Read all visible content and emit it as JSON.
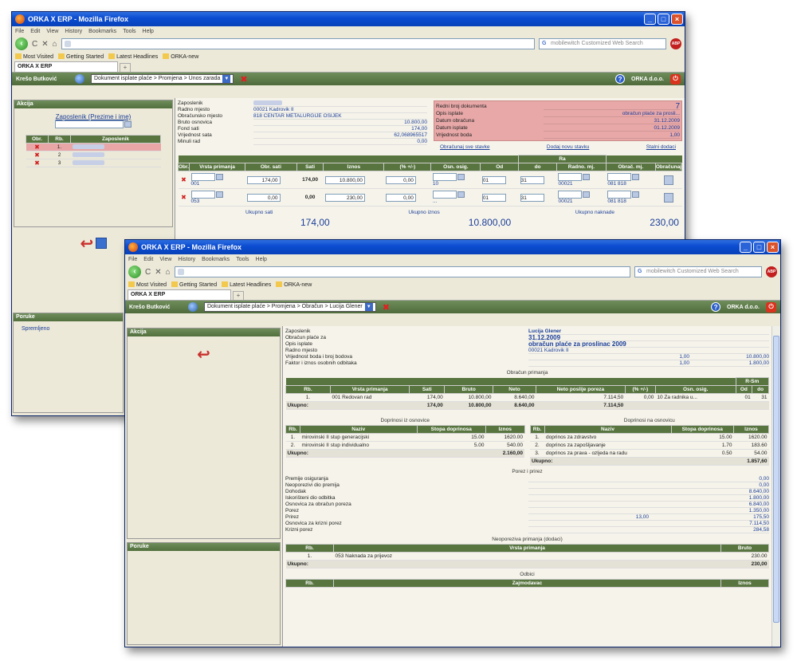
{
  "win1": {
    "title": "ORKA X ERP - Mozilla Firefox",
    "menus": [
      "File",
      "Edit",
      "View",
      "History",
      "Bookmarks",
      "Tools",
      "Help"
    ],
    "search_placeholder": "mobilewitch Customized Web Search",
    "bookmarks": [
      "Most Visited",
      "Getting Started",
      "Latest Headlines",
      "ORKA-new"
    ],
    "tab": "ORKA X ERP",
    "user": "Krešo Butković",
    "breadcrumb": "Dokument isplate plaće > Promjena > Unos zarada",
    "company": "ORKA d.o.o.",
    "akcija_title": "Akcija",
    "zaposlenik_link": "Zaposlenik (Prezime i ime)",
    "emp_table": {
      "headers": [
        "Obr.",
        "Rb.",
        "Zaposlenik"
      ],
      "rows": [
        {
          "rb": "1."
        },
        {
          "rb": "2"
        },
        {
          "rb": "3"
        }
      ]
    },
    "info_labels": [
      "Zaposlenik",
      "Radno mjesto",
      "Obračunsko mjesto",
      "Bruto osnovica",
      "Fond sati",
      "Vrijednost sata",
      "Minuli rad"
    ],
    "info_values": [
      "",
      "00021 Kadrovik II",
      "818 CENTAR METALURGIJE OSIJEK",
      "10.800,00",
      "174,00",
      "62,068965517",
      "0,00"
    ],
    "doc_labels": [
      "Redni broj dokumenta",
      "Opis isplate",
      "Datum obračuna",
      "Datum isplate",
      "Vrijednost boda"
    ],
    "doc_values": [
      "7",
      "obračun plaće za prosli...",
      "31.12.2009",
      "01.12.2009",
      "1,00"
    ],
    "actions": [
      "Obračunaj sve stavke",
      "Dodaj novu stavku",
      "Stalni dodaci"
    ],
    "grid_group": "Ra",
    "grid_headers": [
      "Obr.",
      "Vrsta primanja",
      "Obr. sati",
      "Sati",
      "Iznos",
      "(% +/-)",
      "Osn. osig.",
      "Od",
      "do",
      "Radno. mj.",
      "Obrač. mj.",
      "Obračunaj"
    ],
    "grid_rows": [
      {
        "code": "001",
        "obr_sati": "174,00",
        "sati": "174,00",
        "iznos": "10.800,00",
        "pct": "0,00",
        "osn": "10",
        "od": "01",
        "do": "31",
        "rm": "00021",
        "om": "081 818"
      },
      {
        "code": "053",
        "obr_sati": "0,00",
        "sati": "0,00",
        "iznos": "230,00",
        "pct": "0,00",
        "osn": "...",
        "od": "01",
        "do": "31",
        "rm": "00021",
        "om": "081 818"
      }
    ],
    "totals_labels": [
      "Ukupno sati",
      "Ukupno iznos",
      "Ukupno naknade"
    ],
    "totals_values": [
      "174,00",
      "10.800,00",
      "230,00"
    ]
  },
  "win2": {
    "title": "ORKA X ERP - Mozilla Firefox",
    "menus": [
      "File",
      "Edit",
      "View",
      "History",
      "Bookmarks",
      "Tools",
      "Help"
    ],
    "search_placeholder": "mobilewitch Customized Web Search",
    "bookmarks": [
      "Most Visited",
      "Getting Started",
      "Latest Headlines",
      "ORKA-new"
    ],
    "tab": "ORKA X ERP",
    "user": "Krešo Butković",
    "breadcrumb": "Dokument isplate plaće > Promjena > Obračun > Lucija Glener",
    "company": "ORKA d.o.o.",
    "poruke_title": "Poruke",
    "poruke_msg": "Spremljeno",
    "akcija_title": "Akcija",
    "header_labels": [
      "Zaposlenik",
      "Obračun plaće za",
      "Opis isplate",
      "Radno mjesto",
      "Vrijednost boda i broj bodova",
      "Faktor i iznos osobnih odbitaka"
    ],
    "header_values": [
      "Lucija Glener",
      "31.12.2009",
      "obračun plaće za proslinac 2009",
      "00021 Kadrovik II",
      "1,00",
      "1,00"
    ],
    "header_extra": [
      "",
      "",
      "",
      "",
      "10.800,00",
      "1.800,00"
    ],
    "obracun_title": "Obračun primanja",
    "obracun_group": "R-Sm",
    "obracun_headers": [
      "Rb.",
      "Vrsta primanja",
      "Sati",
      "Bruto",
      "Neto",
      "Neto poslije poreza",
      "(% +/-)",
      "Osn. osig.",
      "Od",
      "do"
    ],
    "obracun_rows": [
      [
        "1.",
        "001 Redovan rad",
        "174,00",
        "10.800,00",
        "8.640,00",
        "7.114,50",
        "0,00",
        "10 Za radnika u...",
        "01",
        "31"
      ]
    ],
    "obracun_total": [
      "Ukupno:",
      "",
      "174,00",
      "10.800,00",
      "8.640,00",
      "7.114,50",
      "",
      "",
      "",
      ""
    ],
    "doprinosi_iz_title": "Doprinosi iz osnovice",
    "doprinosi_iz_headers": [
      "Rb.",
      "Naziv",
      "Stopa doprinosa",
      "Iznos"
    ],
    "doprinosi_iz_rows": [
      [
        "1.",
        "mirovinski II stup generacijski",
        "15.00",
        "1620.00"
      ],
      [
        "2.",
        "mirovinski II stup individualno",
        "5.00",
        "540.00"
      ]
    ],
    "doprinosi_iz_total": [
      "Ukupno:",
      "",
      "",
      "2.160,00"
    ],
    "doprinosi_na_title": "Doprinosi na osnovicu",
    "doprinosi_na_headers": [
      "Rb.",
      "Naziv",
      "Stopa doprinosa",
      "Iznos"
    ],
    "doprinosi_na_rows": [
      [
        "1.",
        "doprinos za zdravstvo",
        "15.00",
        "1620.00"
      ],
      [
        "2.",
        "doprinos za zapošljavanje",
        "1.70",
        "183.60"
      ],
      [
        "3.",
        "doprinos za prava - ozljeda na radu",
        "0.50",
        "54.00"
      ]
    ],
    "doprinosi_na_total": [
      "Ukupno:",
      "",
      "",
      "1.857,60"
    ],
    "porez_title": "Porez i prirez",
    "porez_labels": [
      "Premije osiguranja",
      "Neoporezivi dio premija",
      "Dohodak",
      "Iskorišteni dio odbitka",
      "Osnovica za obračun poreza",
      "Porez",
      "Prirez",
      "Osnovica za krizni porez",
      "Krizni porez"
    ],
    "porez_mid": [
      "",
      "",
      "",
      "",
      "",
      "",
      "13,00",
      "",
      ""
    ],
    "porez_values": [
      "0,00",
      "0,00",
      "8.640,00",
      "1.800,00",
      "6.840,00",
      "1.350,00",
      "175,50",
      "7.114,50",
      "284,58"
    ],
    "neoporezivo_title": "Neoporeziva primanja (dodaci)",
    "neoporezivo_headers": [
      "Rb.",
      "Vrsta primanja",
      "Bruto"
    ],
    "neoporezivo_rows": [
      [
        "1.",
        "053 Naknada za prijevoz",
        "230.00"
      ]
    ],
    "neoporezivo_total": [
      "Ukupno:",
      "",
      "230,00"
    ],
    "odbici_title": "Odbici",
    "odbici_headers": [
      "Rb.",
      "Zajmodavac",
      "Iznos"
    ]
  }
}
